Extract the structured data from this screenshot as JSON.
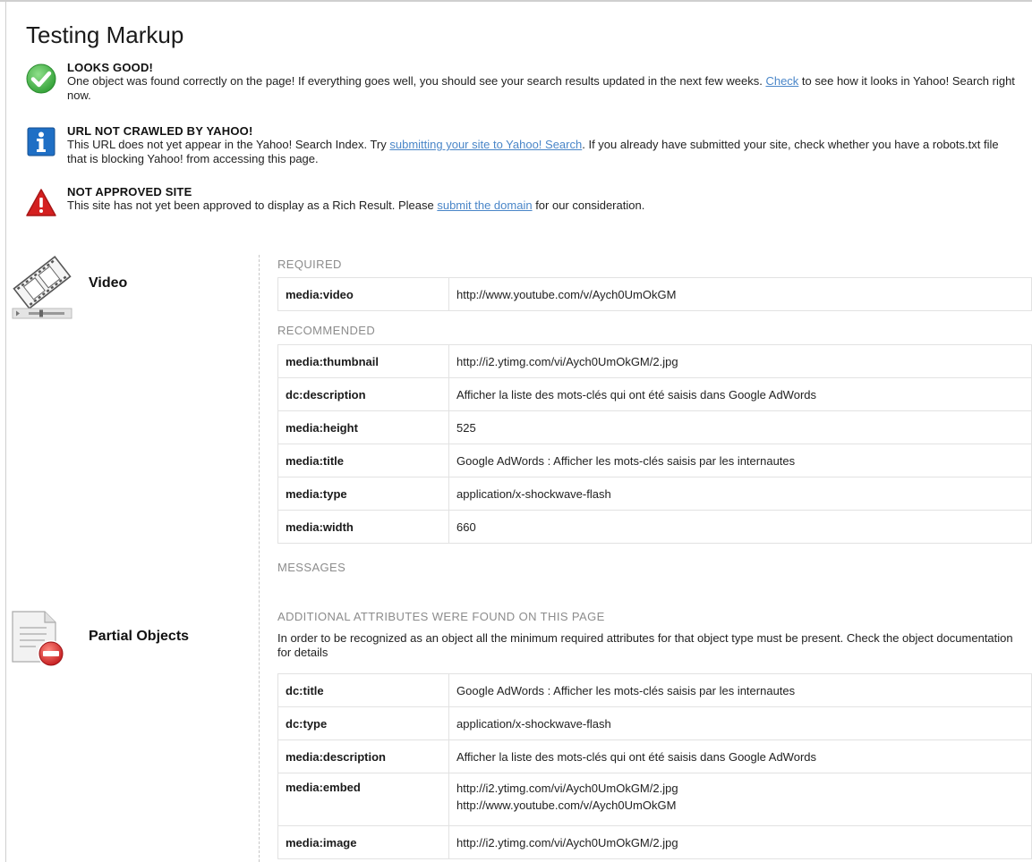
{
  "page": {
    "title": "Testing Markup"
  },
  "notices": [
    {
      "icon": "check-icon",
      "title": "LOOKS GOOD!",
      "text_before": "One object was found correctly on the page! If everything goes well, you should see your search results updated in the next few weeks. ",
      "link": "Check",
      "text_after": " to see how it looks in Yahoo! Search right now."
    },
    {
      "icon": "info-icon",
      "title": "URL NOT CRAWLED BY YAHOO!",
      "text_before": "This URL does not yet appear in the Yahoo! Search Index. Try ",
      "link": "submitting your site to Yahoo! Search",
      "text_after": ". If you already have submitted your site, check whether you have a robots.txt file that is blocking Yahoo! from accessing this page."
    },
    {
      "icon": "warning-icon",
      "title": "NOT APPROVED SITE",
      "text_before": "This site has not yet been approved to display as a Rich Result. Please ",
      "link": "submit the domain",
      "text_after": " for our consideration."
    }
  ],
  "video_section": {
    "label": "Video",
    "icon": "film-icon",
    "required_heading": "REQUIRED",
    "required": [
      {
        "key": "media:video",
        "value": "http://www.youtube.com/v/Aych0UmOkGM"
      }
    ],
    "recommended_heading": "RECOMMENDED",
    "recommended": [
      {
        "key": "media:thumbnail",
        "value": "http://i2.ytimg.com/vi/Aych0UmOkGM/2.jpg"
      },
      {
        "key": "dc:description",
        "value": "Afficher la liste des mots-clés qui ont été saisis dans Google AdWords"
      },
      {
        "key": "media:height",
        "value": "525"
      },
      {
        "key": "media:title",
        "value": "Google AdWords : Afficher les mots-clés saisis par les internautes"
      },
      {
        "key": "media:type",
        "value": "application/x-shockwave-flash"
      },
      {
        "key": "media:width",
        "value": "660"
      }
    ],
    "messages_heading": "MESSAGES"
  },
  "partial_section": {
    "label": "Partial Objects",
    "icon": "document-blocked-icon",
    "heading": "ADDITIONAL ATTRIBUTES WERE FOUND ON THIS PAGE",
    "description": "In order to be recognized as an object all the minimum required attributes for that object type must be present. Check the object documentation for details",
    "attributes": [
      {
        "key": "dc:title",
        "value": "Google AdWords : Afficher les mots-clés saisis par les internautes"
      },
      {
        "key": "dc:type",
        "value": "application/x-shockwave-flash"
      },
      {
        "key": "media:description",
        "value": "Afficher la liste des mots-clés qui ont été saisis dans Google AdWords"
      },
      {
        "key": "media:embed",
        "value": "http://i2.ytimg.com/vi/Aych0UmOkGM/2.jpg",
        "value2": "http://www.youtube.com/v/Aych0UmOkGM"
      },
      {
        "key": "media:image",
        "value": "http://i2.ytimg.com/vi/Aych0UmOkGM/2.jpg"
      }
    ]
  },
  "colors": {
    "link": "#4a86c8",
    "heading": "#8c8c8c",
    "success": "#3cb043",
    "info": "#1f6fc5",
    "warning": "#d42020"
  }
}
